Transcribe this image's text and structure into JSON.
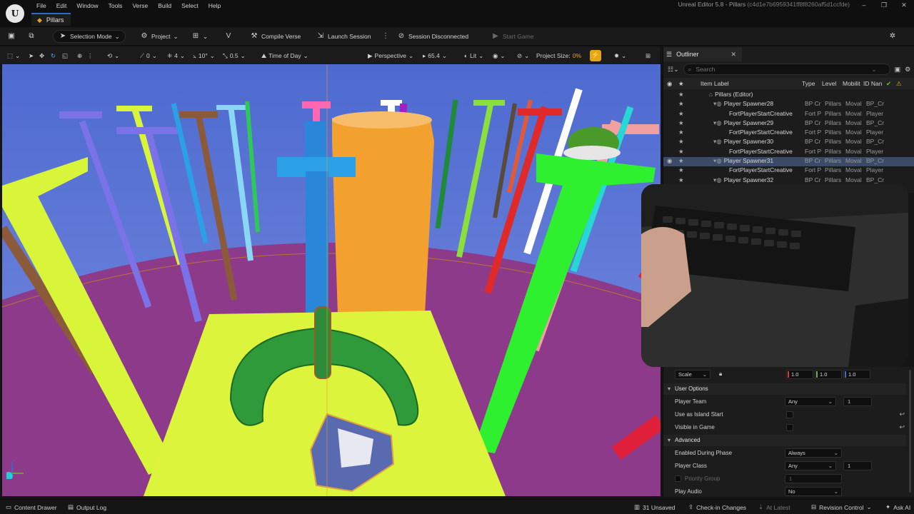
{
  "app": {
    "logo_text": "U",
    "menu": [
      "File",
      "Edit",
      "Window",
      "Tools",
      "Verse",
      "Build",
      "Select",
      "Help"
    ],
    "level_tab": "Pillars",
    "window_title": "Unreal Editor 5.8 - Pillars",
    "window_hash": "(c4d1e7b6959341ff8f8260af5d1ccfde)",
    "window_controls": [
      "–",
      "❐",
      "✕"
    ]
  },
  "toolbar": {
    "selection_mode": "Selection Mode",
    "project": "Project",
    "compile_verse": "Compile Verse",
    "launch_session": "Launch Session",
    "session_status": "Session Disconnected",
    "start_game": "Start Game"
  },
  "viewport_toolbar": {
    "snap_rotation": "0",
    "grid_snap": "4",
    "rotation_snap": "10°",
    "scale_snap": "0.5",
    "time_of_day": "Time of Day",
    "perspective": "Perspective",
    "fov": "65.4",
    "view_mode": "Lit",
    "project_size_label": "Project Size:",
    "project_size_value": "0%"
  },
  "outliner": {
    "tab_label": "Outliner",
    "search_placeholder": "Search",
    "columns": {
      "item_label": "Item Label",
      "type": "Type",
      "level": "Level",
      "mobility": "Mobilit",
      "id_name": "ID Nan"
    },
    "rows": [
      {
        "label": "Pillars (Editor)",
        "type": "",
        "level": "",
        "mobility": "",
        "id": "",
        "depth": 0,
        "eye": false,
        "selected": false
      },
      {
        "label": "Player Spawner28",
        "type": "BP Cr",
        "level": "Pillars",
        "mobility": "Moval",
        "id": "BP_Cr",
        "depth": 1,
        "eye": false,
        "selected": false
      },
      {
        "label": "FortPlayerStartCreative",
        "type": "Fort P",
        "level": "Pillars",
        "mobility": "Moval",
        "id": "Player",
        "depth": 2,
        "eye": false,
        "selected": false
      },
      {
        "label": "Player Spawner29",
        "type": "BP Cr",
        "level": "Pillars",
        "mobility": "Moval",
        "id": "BP_Cr",
        "depth": 1,
        "eye": false,
        "selected": false
      },
      {
        "label": "FortPlayerStartCreative",
        "type": "Fort P",
        "level": "Pillars",
        "mobility": "Moval",
        "id": "Player",
        "depth": 2,
        "eye": false,
        "selected": false
      },
      {
        "label": "Player Spawner30",
        "type": "BP Cr",
        "level": "Pillars",
        "mobility": "Moval",
        "id": "BP_Cr",
        "depth": 1,
        "eye": false,
        "selected": false
      },
      {
        "label": "FortPlayerStartCreative",
        "type": "Fort P",
        "level": "Pillars",
        "mobility": "Moval",
        "id": "Player",
        "depth": 2,
        "eye": false,
        "selected": false
      },
      {
        "label": "Player Spawner31",
        "type": "BP Cr",
        "level": "Pillars",
        "mobility": "Moval",
        "id": "BP_Cr",
        "depth": 1,
        "eye": true,
        "selected": true
      },
      {
        "label": "FortPlayerStartCreative",
        "type": "Fort P",
        "level": "Pillars",
        "mobility": "Moval",
        "id": "Player",
        "depth": 2,
        "eye": false,
        "selected": false
      },
      {
        "label": "Player Spawner32",
        "type": "BP Cr",
        "level": "Pillars",
        "mobility": "Moval",
        "id": "BP_Cr",
        "depth": 1,
        "eye": false,
        "selected": false
      },
      {
        "label": "FortPlayerStartCreative",
        "type": "Fort P",
        "level": "Pillars",
        "mobility": "Moval",
        "id": "Player",
        "depth": 2,
        "eye": false,
        "selected": false
      }
    ]
  },
  "details": {
    "scale_label": "Scale",
    "scale_x": "1.0",
    "scale_y": "1.0",
    "scale_z": "1.0",
    "user_options_section": "User Options",
    "player_team_label": "Player Team",
    "player_team_value": "Any",
    "player_team_number": "1",
    "island_start_label": "Use as Island Start",
    "visible_in_game_label": "Visible in Game",
    "advanced_section": "Advanced",
    "enabled_phase_label": "Enabled During Phase",
    "enabled_phase_value": "Always",
    "player_class_label": "Player Class",
    "player_class_value": "Any",
    "player_class_number": "1",
    "priority_group_label": "Priority Group",
    "priority_group_value": "1",
    "play_audio_label": "Play Audio",
    "play_audio_value": "No"
  },
  "statusbar": {
    "content_drawer": "Content Drawer",
    "output_log": "Output Log",
    "unsaved": "31 Unsaved",
    "check_in": "Check-in Changes",
    "at_latest": "At Latest",
    "revision_control": "Revision Control",
    "ask_ai": "Ask AI"
  },
  "colors": {
    "accent_blue": "#2b6bd6",
    "accent_orange": "#e3a51a",
    "selection_row": "#3b4a66",
    "sky": "#5f78d2",
    "floor_purple": "#8e3a8a",
    "platform_yellow": "#d8f53a"
  }
}
